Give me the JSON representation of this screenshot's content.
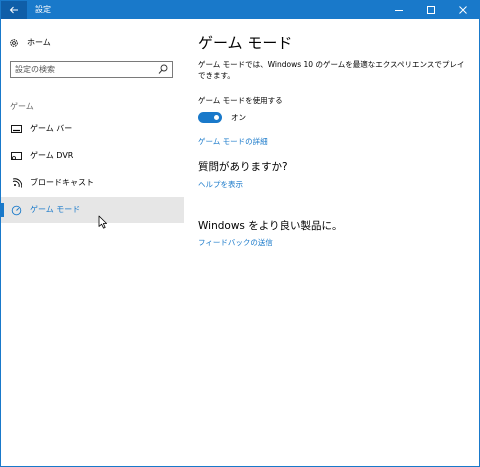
{
  "window": {
    "title": "設定"
  },
  "sidebar": {
    "home_label": "ホーム",
    "search_placeholder": "設定の検索",
    "section_heading": "ゲーム",
    "items": [
      {
        "label": "ゲーム バー",
        "icon": "game-bar-icon"
      },
      {
        "label": "ゲーム DVR",
        "icon": "game-dvr-icon"
      },
      {
        "label": "ブロードキャスト",
        "icon": "broadcast-icon"
      },
      {
        "label": "ゲーム モード",
        "icon": "game-mode-icon",
        "selected": true
      }
    ]
  },
  "main": {
    "title": "ゲーム モード",
    "description": "ゲーム モードでは、Windows 10 のゲームを最適なエクスペリエンスでプレイできます。",
    "toggle_label": "ゲーム モードを使用する",
    "toggle_state": "オン",
    "toggle_on": true,
    "details_link": "ゲーム モードの詳細",
    "help_heading": "質問がありますか?",
    "help_link": "ヘルプを表示",
    "feedback_heading": "Windows をより良い製品に。",
    "feedback_link": "フィードバックの送信"
  },
  "colors": {
    "accent": "#1979ca",
    "selected_bg": "#e6e6e6"
  }
}
